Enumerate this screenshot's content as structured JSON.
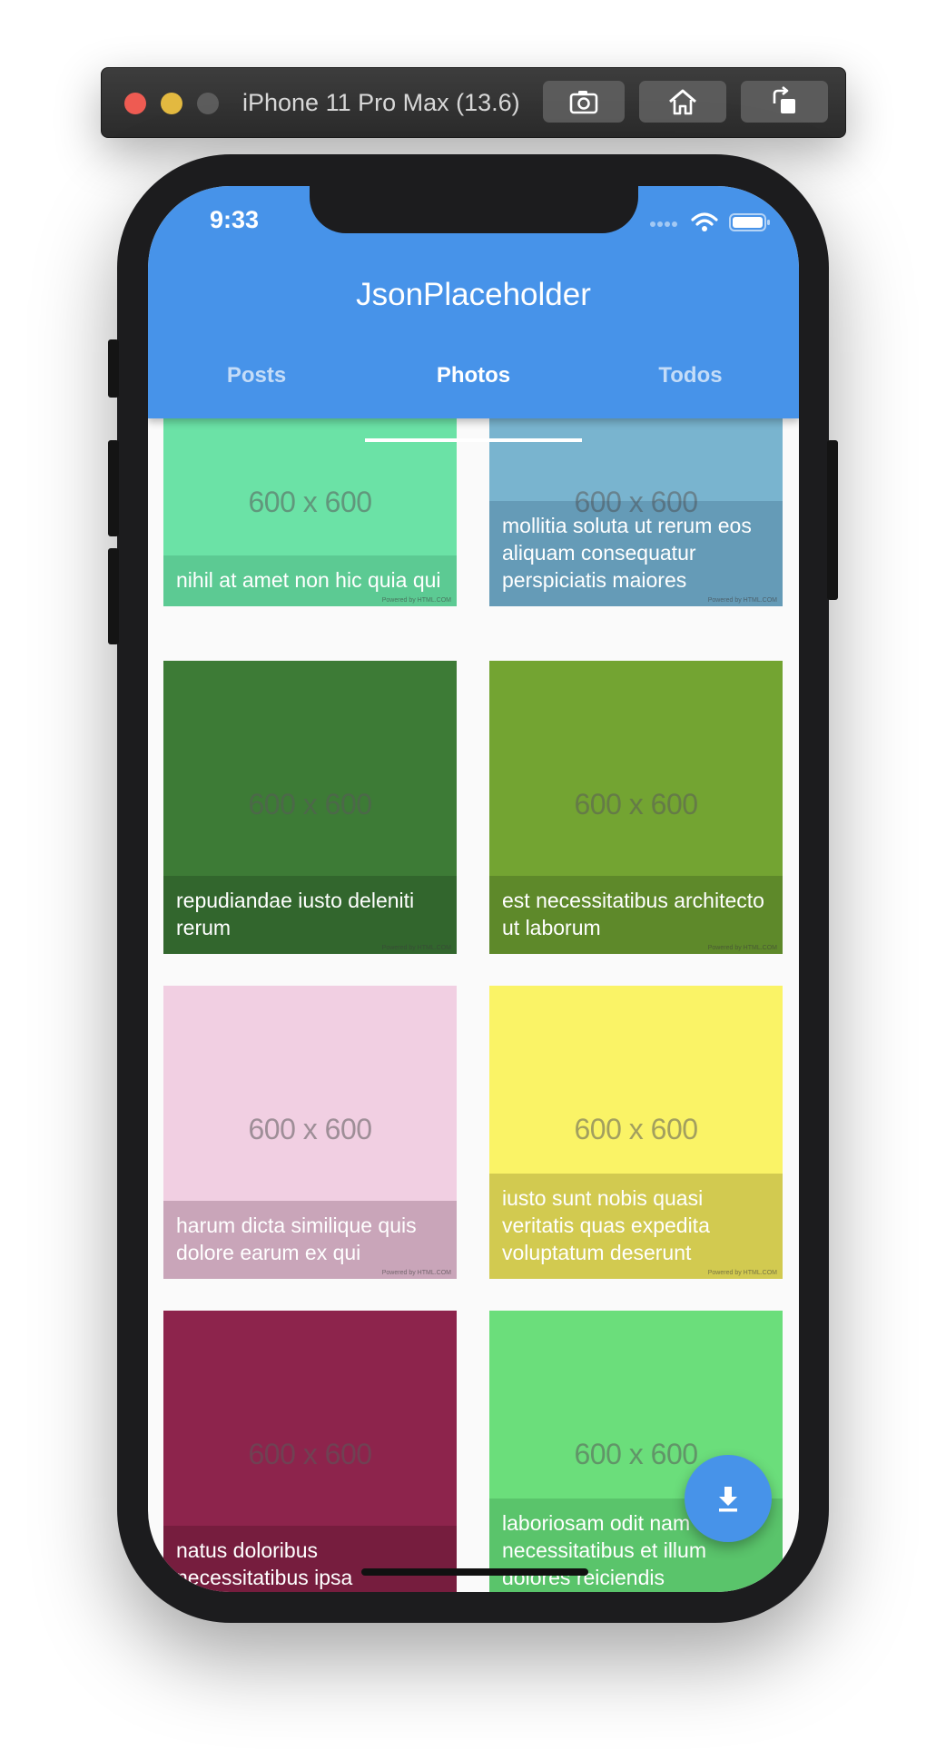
{
  "simulator": {
    "title": "iPhone 11 Pro Max (13.6)",
    "buttons": [
      "screenshot",
      "home",
      "rotate"
    ]
  },
  "status_bar": {
    "time": "9:33"
  },
  "app_bar": {
    "title": "JsonPlaceholder",
    "tabs": [
      {
        "label": "Posts",
        "active": false
      },
      {
        "label": "Photos",
        "active": true
      },
      {
        "label": "Todos",
        "active": false
      }
    ]
  },
  "photos": [
    {
      "placeholder": "600 x 600",
      "caption": "nihil at amet non hic quia qui",
      "color": "#6be2a6",
      "powered": "Powered by HTML.COM"
    },
    {
      "placeholder": "600 x 600",
      "caption": "mollitia soluta ut rerum eos aliquam consequatur perspiciatis maiores",
      "color": "#79b4cf",
      "powered": "Powered by HTML.COM"
    },
    {
      "placeholder": "600 x 600",
      "caption": "repudiandae iusto deleniti rerum",
      "color": "#3d7b36",
      "powered": "Powered by HTML.COM"
    },
    {
      "placeholder": "600 x 600",
      "caption": "est necessitatibus architecto ut laborum",
      "color": "#73a432",
      "powered": "Powered by HTML.COM"
    },
    {
      "placeholder": "600 x 600",
      "caption": "harum dicta similique quis dolore earum ex qui",
      "color": "#f1cfe2",
      "powered": "Powered by HTML.COM"
    },
    {
      "placeholder": "600 x 600",
      "caption": "iusto sunt nobis quasi veritatis quas expedita voluptatum deserunt",
      "color": "#faf366",
      "powered": "Powered by HTML.COM"
    },
    {
      "placeholder": "600 x 600",
      "caption": "natus doloribus necessitatibus ipsa",
      "color": "#8d244c",
      "powered": ""
    },
    {
      "placeholder": "600 x 600",
      "caption": "laboriosam odit nam necessitatibus et illum dolores reiciendis",
      "color": "#6bde7b",
      "powered": ""
    }
  ],
  "fab": {
    "icon": "download-icon",
    "color": "#4793e9"
  }
}
